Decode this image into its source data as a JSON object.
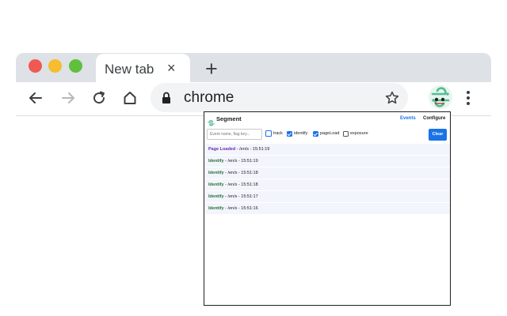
{
  "browser": {
    "tab_title": "New tab",
    "tab_close": "×",
    "new_tab": "+",
    "address": "chrome"
  },
  "popup": {
    "title": "Segment",
    "nav": {
      "events": "Events",
      "configure": "Configure"
    },
    "search_placeholder": "Event name, flag key...",
    "filters": [
      {
        "label": "track",
        "checked": false
      },
      {
        "label": "identify",
        "checked": true
      },
      {
        "label": "pageLoad",
        "checked": true
      },
      {
        "label": "exposure",
        "checked": false
      }
    ],
    "clear_label": "Clear",
    "events": [
      {
        "name": "Page Loaded",
        "meta": " - /en/s - 15:51:19",
        "kind": "page"
      },
      {
        "name": "Identify",
        "meta": " - /en/s - 15:51:19",
        "kind": "identify"
      },
      {
        "name": "Identify",
        "meta": " - /en/s - 15:51:18",
        "kind": "identify"
      },
      {
        "name": "Identify",
        "meta": " - /en/s - 15:51:18",
        "kind": "identify"
      },
      {
        "name": "Identify",
        "meta": " - /en/s - 15:51:17",
        "kind": "identify"
      },
      {
        "name": "Identify",
        "meta": " - /en/s - 15:51:16",
        "kind": "identify"
      }
    ]
  },
  "colors": {
    "accent": "#1a73e8",
    "page_event": "#6a2da8",
    "identify_event": "#2a6e3a",
    "segment_green": "#52bd94"
  }
}
